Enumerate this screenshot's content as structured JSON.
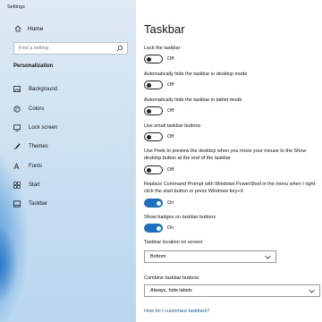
{
  "window": {
    "title": "Settings"
  },
  "sidebar": {
    "home_label": "Home",
    "search_placeholder": "Find a setting",
    "section_label": "Personalization",
    "items": [
      {
        "label": "Background",
        "icon": "picture-icon"
      },
      {
        "label": "Colors",
        "icon": "palette-icon"
      },
      {
        "label": "Lock screen",
        "icon": "monitor-lock-icon"
      },
      {
        "label": "Themes",
        "icon": "brush-icon"
      },
      {
        "label": "Fonts",
        "icon": "font-icon"
      },
      {
        "label": "Start",
        "icon": "start-grid-icon"
      },
      {
        "label": "Taskbar",
        "icon": "taskbar-icon"
      }
    ]
  },
  "main": {
    "title": "Taskbar",
    "settings": [
      {
        "label": "Lock the taskbar",
        "state": "Off"
      },
      {
        "label": "Automatically hide the taskbar in desktop mode",
        "state": "Off"
      },
      {
        "label": "Automatically hide the taskbar in tablet mode",
        "state": "Off"
      },
      {
        "label": "Use small taskbar buttons",
        "state": "Off"
      },
      {
        "label": "Use Peek to preview the desktop when you move your mouse to the Show desktop button at the end of the taskbar",
        "state": "Off"
      },
      {
        "label": "Replace Command Prompt with Windows PowerShell in the menu when I right-click the start button or press Windows key+X",
        "state": "On"
      },
      {
        "label": "Show badges on taskbar buttons",
        "state": "On"
      }
    ],
    "location_label": "Taskbar location on screen",
    "location_value": "Bottom",
    "combine_label": "Combine taskbar buttons",
    "combine_value": "Always, hide labels",
    "help_link": "How do I customize taskbars?"
  },
  "colors": {
    "accent": "#1c6fc2",
    "link": "#1563b8"
  }
}
